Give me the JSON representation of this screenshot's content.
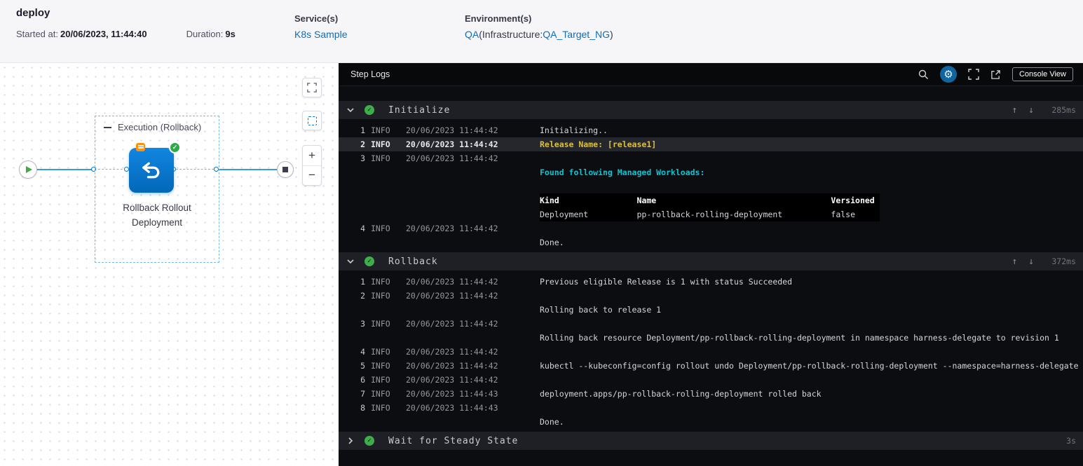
{
  "header": {
    "pipeline_name": "deploy",
    "started_label": "Started at:",
    "started_value": "20/06/2023, 11:44:40",
    "duration_label": "Duration:",
    "duration_value": "9s",
    "services_label": "Service(s)",
    "service_link": "K8s Sample",
    "environments_label": "Environment(s)",
    "environment_link": "QA",
    "infra_prefix": "(Infrastructure:",
    "infra_link": "QA_Target_NG",
    "infra_suffix": ")"
  },
  "canvas": {
    "group_label": "Execution (Rollback)",
    "node_label_line1": "Rollback Rollout",
    "node_label_line2": "Deployment"
  },
  "console": {
    "title": "Step Logs",
    "console_view_button": "Console View",
    "sections": [
      {
        "name": "Initialize",
        "duration": "285ms",
        "expanded": true,
        "lines": [
          {
            "num": "1",
            "level": "INFO",
            "time": "20/06/2023 11:44:42",
            "msg": "Initializing.."
          },
          {
            "num": "2",
            "level": "INFO",
            "time": "20/06/2023 11:44:42",
            "msg": "Release Name: [release1]",
            "cls": "sel"
          },
          {
            "num": "3",
            "level": "INFO",
            "time": "20/06/2023 11:44:42",
            "msg": ""
          },
          {
            "msg": "Found following Managed Workloads:",
            "cls": "cyan"
          },
          {
            "msg": ""
          },
          {
            "msg": "Kind                Name                                    Versioned ",
            "cls": "tblh"
          },
          {
            "msg": "Deployment          pp-rollback-rolling-deployment          false     ",
            "cls": "tbl"
          },
          {
            "num": "4",
            "level": "INFO",
            "time": "20/06/2023 11:44:42",
            "msg": ""
          },
          {
            "msg": "Done."
          }
        ]
      },
      {
        "name": "Rollback",
        "duration": "372ms",
        "expanded": true,
        "lines": [
          {
            "num": "1",
            "level": "INFO",
            "time": "20/06/2023 11:44:42",
            "msg": "Previous eligible Release is 1 with status Succeeded"
          },
          {
            "num": "2",
            "level": "INFO",
            "time": "20/06/2023 11:44:42",
            "msg": ""
          },
          {
            "msg": "Rolling back to release 1"
          },
          {
            "num": "3",
            "level": "INFO",
            "time": "20/06/2023 11:44:42",
            "msg": ""
          },
          {
            "msg": "Rolling back resource Deployment/pp-rollback-rolling-deployment in namespace harness-delegate to revision 1"
          },
          {
            "num": "4",
            "level": "INFO",
            "time": "20/06/2023 11:44:42",
            "msg": ""
          },
          {
            "num": "5",
            "level": "INFO",
            "time": "20/06/2023 11:44:42",
            "msg": "kubectl --kubeconfig=config rollout undo Deployment/pp-rollback-rolling-deployment --namespace=harness-delegate"
          },
          {
            "num": "6",
            "level": "INFO",
            "time": "20/06/2023 11:44:42",
            "msg": ""
          },
          {
            "num": "7",
            "level": "INFO",
            "time": "20/06/2023 11:44:43",
            "msg": "deployment.apps/pp-rollback-rolling-deployment rolled back"
          },
          {
            "num": "8",
            "level": "INFO",
            "time": "20/06/2023 11:44:43",
            "msg": ""
          },
          {
            "msg": "Done."
          }
        ]
      },
      {
        "name": "Wait for Steady State",
        "duration": "3s",
        "expanded": false,
        "lines": []
      }
    ]
  },
  "icons": {
    "check": "✓",
    "scroll_up": "↑",
    "scroll_down": "↓",
    "zoom_in": "+",
    "zoom_out": "−",
    "gear": "⚙"
  },
  "colors": {
    "accent_blue": "#0278d5",
    "success_green": "#42ab45",
    "highlight_yellow": "#d9c13f",
    "info_cyan": "#0fc0ce",
    "link_blue": "#0a6ebd"
  }
}
